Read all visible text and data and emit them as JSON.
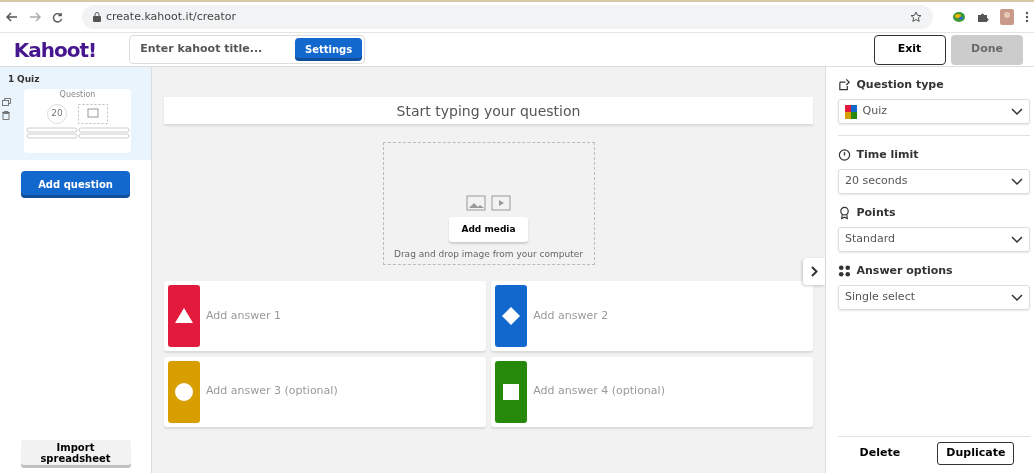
{
  "browser": {
    "url": "create.kahoot.it/creator"
  },
  "header": {
    "logo": "Kahoot!",
    "title_field": {
      "placeholder": "Enter kahoot title..."
    },
    "settings_button": "Settings",
    "exit_button": "Exit",
    "done_button": {
      "label": "Done",
      "disabled": true
    }
  },
  "sidebar": {
    "slides": [
      {
        "number": "1",
        "type": "Quiz",
        "preview_title": "Question",
        "preview_timer": "20",
        "selected": true
      }
    ],
    "add_question_button": "Add question",
    "import_button": "Import spreadsheet"
  },
  "editor": {
    "question": {
      "placeholder": "Start typing your question"
    },
    "media": {
      "button": "Add media",
      "hint": "Drag and drop image from your computer"
    },
    "answers": [
      {
        "placeholder": "Add answer 1",
        "kind": "triangle",
        "color": "#e21b3c"
      },
      {
        "placeholder": "Add answer 2",
        "kind": "diamond",
        "color": "#1368ce"
      },
      {
        "placeholder": "Add answer 3 (optional)",
        "kind": "circle",
        "color": "#d89e00"
      },
      {
        "placeholder": "Add answer 4 (optional)",
        "kind": "square",
        "color": "#26890c"
      }
    ]
  },
  "settings_panel": {
    "sections": [
      {
        "kind": "type",
        "label": "Question type",
        "value": "Quiz"
      },
      {
        "kind": "time",
        "label": "Time limit",
        "value": "20 seconds"
      },
      {
        "kind": "points",
        "label": "Points",
        "value": "Standard"
      },
      {
        "kind": "options",
        "label": "Answer options",
        "value": "Single select"
      }
    ],
    "delete_button": "Delete",
    "duplicate_button": "Duplicate"
  }
}
